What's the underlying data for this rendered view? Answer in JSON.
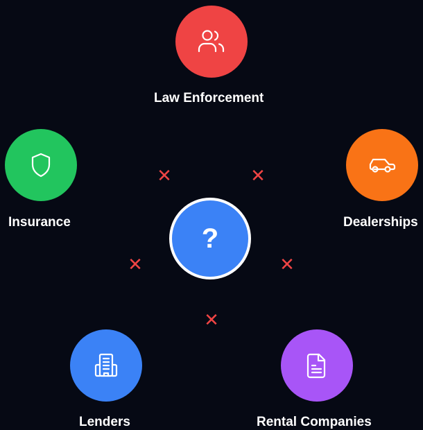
{
  "center": {
    "symbol": "?",
    "color": "#3b82f6"
  },
  "nodes": [
    {
      "label": "Law Enforcement",
      "icon": "users-icon",
      "color": "#ef4444"
    },
    {
      "label": "Dealerships",
      "icon": "car-icon",
      "color": "#f97316"
    },
    {
      "label": "Rental Companies",
      "icon": "document-icon",
      "color": "#a855f7"
    },
    {
      "label": "Lenders",
      "icon": "building-icon",
      "color": "#3b82f6"
    },
    {
      "label": "Insurance",
      "icon": "shield-icon",
      "color": "#22c55e"
    }
  ],
  "disconnect_marker": {
    "symbol": "✕",
    "color": "#ef4444"
  }
}
